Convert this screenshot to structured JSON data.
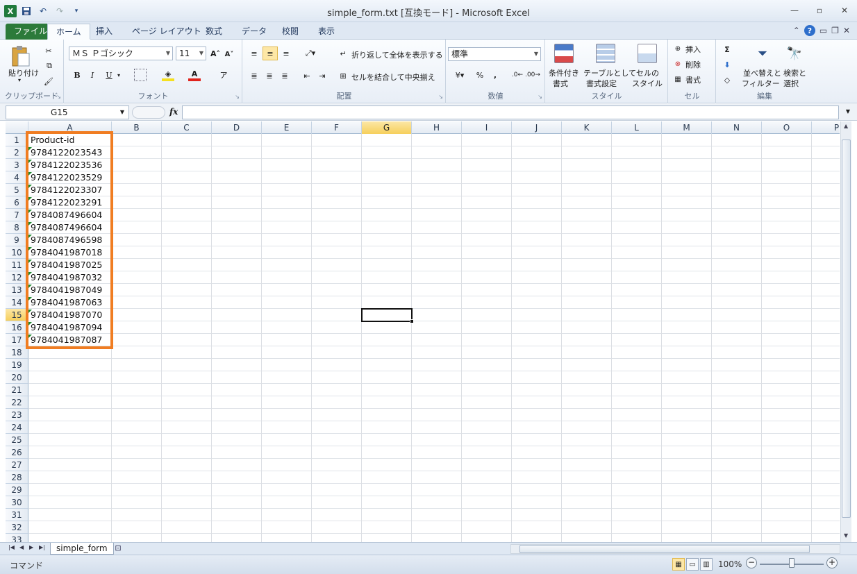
{
  "app": {
    "window_title": "simple_form.txt  [互換モード]  -  Microsoft Excel",
    "accent": "#2c7a3a",
    "highlight_color": "#f07d22"
  },
  "qat": {
    "icons": [
      "excel-app-icon",
      "save-icon",
      "undo-icon",
      "redo-icon",
      "customize-qat-icon"
    ]
  },
  "tabs": [
    "ファイル",
    "ホーム",
    "挿入",
    "ページ レイアウト",
    "数式",
    "データ",
    "校閲",
    "表示"
  ],
  "ribbon": {
    "clipboard": {
      "label": "クリップボード",
      "paste": "貼り付け"
    },
    "font": {
      "label": "フォント",
      "font_name": "ＭＳ Ｐゴシック",
      "font_size": "11",
      "bold": "B",
      "italic": "I",
      "underline": "U"
    },
    "alignment": {
      "label": "配置",
      "wrap": "折り返して全体を表示する",
      "merge": "セルを結合して中央揃え"
    },
    "number": {
      "label": "数値",
      "format": "標準",
      "percent": "%",
      "comma": ","
    },
    "styles": {
      "label": "スタイル",
      "conditional": [
        "条件付き",
        "書式"
      ],
      "table": [
        "テーブルとして",
        "書式設定"
      ],
      "cell_style": [
        "セルの",
        "スタイル"
      ]
    },
    "cells": {
      "label": "セル",
      "insert": "挿入",
      "delete": "削除",
      "format": "書式"
    },
    "editing": {
      "label": "編集",
      "sort": [
        "並べ替えと",
        "フィルター"
      ],
      "find": [
        "検索と",
        "選択"
      ]
    }
  },
  "formula_bar": {
    "name_box": "G15",
    "fx": "fx",
    "value": ""
  },
  "columns": [
    "A",
    "B",
    "C",
    "D",
    "E",
    "F",
    "G",
    "H",
    "I",
    "J",
    "K",
    "L",
    "M",
    "N",
    "O",
    "P"
  ],
  "rows": [
    "1",
    "2",
    "3",
    "4",
    "5",
    "6",
    "7",
    "8",
    "9",
    "10",
    "11",
    "12",
    "13",
    "14",
    "15",
    "16",
    "17",
    "18",
    "19",
    "20",
    "21",
    "22",
    "23",
    "24",
    "25",
    "26",
    "27",
    "28",
    "29",
    "30",
    "31",
    "32",
    "33"
  ],
  "column_a": [
    "Product-id",
    "9784122023543",
    "9784122023536",
    "9784122023529",
    "9784122023307",
    "9784122023291",
    "9784087496604",
    "9784087496604",
    "9784087496598",
    "9784041987018",
    "9784041987025",
    "9784041987032",
    "9784041987049",
    "9784041987063",
    "9784041987070",
    "9784041987094",
    "9784041987087"
  ],
  "sheet": {
    "tab_name": "simple_form"
  },
  "status": {
    "mode": "コマンド",
    "zoom": "100%"
  }
}
